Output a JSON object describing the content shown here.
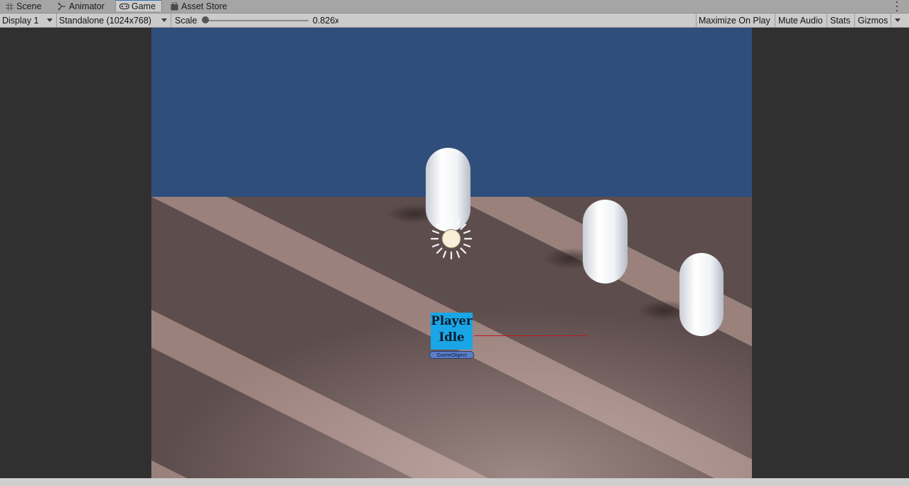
{
  "tabs": [
    {
      "label": "Scene",
      "icon": "grid-icon",
      "active": false
    },
    {
      "label": "Animator",
      "icon": "animator-icon",
      "active": false
    },
    {
      "label": "Game",
      "icon": "gamepad-icon",
      "active": true
    },
    {
      "label": "Asset Store",
      "icon": "store-bag-icon",
      "active": false
    }
  ],
  "toolbar": {
    "display": "Display 1",
    "resolution": "Standalone (1024x768)",
    "scale_label": "Scale",
    "scale_value": "0.826x",
    "maximize": "Maximize On Play",
    "mute": "Mute Audio",
    "stats": "Stats",
    "gizmos": "Gizmos"
  },
  "scene": {
    "player_label_line1": "Player",
    "player_label_line2": "Idle",
    "gameobject_tag": "GameObject",
    "colors": {
      "sky": "#2f4e7b",
      "floor_light": "#9a817c",
      "floor_dark": "#5e4d4d",
      "capsule": "#f2f4f7",
      "player_label_bg": "#1aa6e6",
      "gizmo_line": "#c0191a",
      "sun": "#f8efd8"
    }
  }
}
